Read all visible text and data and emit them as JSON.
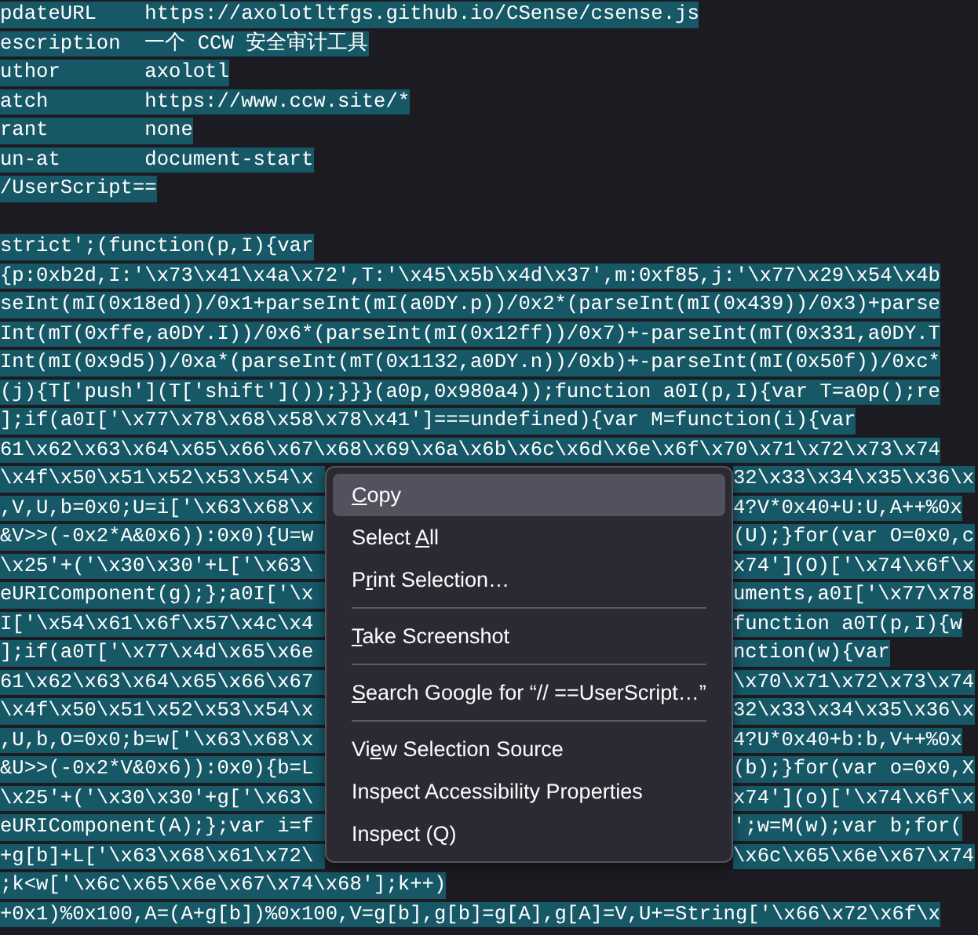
{
  "editor": {
    "selected": true,
    "header_lines": [
      "pdateURL    https://axolotltfgs.github.io/CSense/csense.js",
      "escription  一个 CCW 安全审计工具",
      "uthor       axolotl",
      "atch        https://www.ccw.site/*",
      "rant        none",
      "un-at       document-start",
      "/UserScript=="
    ],
    "code_lines": [
      {
        "kind": "full",
        "text": "strict';(function(p,I){var"
      },
      {
        "kind": "full",
        "text": "{p:0xb2d,I:'\\x73\\x41\\x4a\\x72',T:'\\x45\\x5b\\x4d\\x37',m:0xf85,j:'\\x77\\x29\\x54\\x4b"
      },
      {
        "kind": "full",
        "text": "seInt(mI(0x18ed))/0x1+parseInt(mI(a0DY.p))/0x2*(parseInt(mI(0x439))/0x3)+parse"
      },
      {
        "kind": "full",
        "text": "Int(mT(0xffe,a0DY.I))/0x6*(parseInt(mI(0x12ff))/0x7)+-parseInt(mT(0x331,a0DY.T"
      },
      {
        "kind": "full",
        "text": "Int(mI(0x9d5))/0xa*(parseInt(mT(0x1132,a0DY.n))/0xb)+-parseInt(mI(0x50f))/0xc*"
      },
      {
        "kind": "full",
        "text": "(j){T['push'](T['shift']());}}}(a0p,0x980a4));function a0I(p,I){var T=a0p();re"
      },
      {
        "kind": "full",
        "text": "];if(a0I['\\x77\\x78\\x68\\x58\\x78\\x41']===undefined){var M=function(i){var"
      },
      {
        "kind": "full",
        "text": "61\\x62\\x63\\x64\\x65\\x66\\x67\\x68\\x69\\x6a\\x6b\\x6c\\x6d\\x6e\\x6f\\x70\\x71\\x72\\x73\\x74"
      },
      {
        "kind": "split",
        "left": "\\x4f\\x50\\x51\\x52\\x53\\x54\\x",
        "right": "32\\x33\\x34\\x35\\x36\\x"
      },
      {
        "kind": "split",
        "left": ",V,U,b=0x0;U=i['\\x63\\x68\\x",
        "right": "4?V*0x40+U:U,A++%0x"
      },
      {
        "kind": "split",
        "left": "&V>>(-0x2*A&0x6)):0x0){U=w",
        "right": "(U);}for(var O=0x0,c"
      },
      {
        "kind": "split",
        "left": "\\x25'+('\\x30\\x30'+L['\\x63\\",
        "right": "x74'](O)['\\x74\\x6f\\x"
      },
      {
        "kind": "split",
        "left": "eURIComponent(g);};a0I['\\x",
        "right": "uments,a0I['\\x77\\x78"
      },
      {
        "kind": "split",
        "left": "I['\\x54\\x61\\x6f\\x57\\x4c\\x4",
        "right": "function a0T(p,I){w"
      },
      {
        "kind": "split",
        "left": "];if(a0T['\\x77\\x4d\\x65\\x6e",
        "right": "nction(w){var"
      },
      {
        "kind": "split",
        "left": "61\\x62\\x63\\x64\\x65\\x66\\x67",
        "right": "\\x70\\x71\\x72\\x73\\x74"
      },
      {
        "kind": "split",
        "left": "\\x4f\\x50\\x51\\x52\\x53\\x54\\x",
        "right": "32\\x33\\x34\\x35\\x36\\x"
      },
      {
        "kind": "split",
        "left": ",U,b,O=0x0;b=w['\\x63\\x68\\x",
        "right": "4?U*0x40+b:b,V++%0x"
      },
      {
        "kind": "split",
        "left": "&U>>(-0x2*V&0x6)):0x0){b=L",
        "right": "(b);}for(var o=0x0,X"
      },
      {
        "kind": "split",
        "left": "\\x25'+('\\x30\\x30'+g['\\x63\\",
        "right": "x74'](o)['\\x74\\x6f\\x"
      },
      {
        "kind": "split",
        "left": "eURIComponent(A);};var i=f",
        "right": "';w=M(w);var b;for("
      },
      {
        "kind": "split",
        "left": "+g[b]+L['\\x63\\x68\\x61\\x72\\",
        "right": "\\x6c\\x65\\x6e\\x67\\x74"
      },
      {
        "kind": "full",
        "text": ";k<w['\\x6c\\x65\\x6e\\x67\\x74\\x68'];k++)"
      },
      {
        "kind": "full",
        "text": "+0x1)%0x100,A=(A+g[b])%0x100,V=g[b],g[b]=g[A],g[A]=V,U+=String['\\x66\\x72\\x6f\\x"
      }
    ]
  },
  "context_menu": {
    "items": [
      {
        "kind": "item",
        "selected": true,
        "parts": [
          {
            "text": "C",
            "underline": true
          },
          {
            "text": "opy",
            "underline": false
          }
        ]
      },
      {
        "kind": "item",
        "selected": false,
        "parts": [
          {
            "text": "Select ",
            "underline": false
          },
          {
            "text": "A",
            "underline": true
          },
          {
            "text": "ll",
            "underline": false
          }
        ]
      },
      {
        "kind": "item",
        "selected": false,
        "parts": [
          {
            "text": "P",
            "underline": false
          },
          {
            "text": "r",
            "underline": true
          },
          {
            "text": "int Selection…",
            "underline": false
          }
        ]
      },
      {
        "kind": "separator"
      },
      {
        "kind": "item",
        "selected": false,
        "parts": [
          {
            "text": "T",
            "underline": true
          },
          {
            "text": "ake Screenshot",
            "underline": false
          }
        ]
      },
      {
        "kind": "separator"
      },
      {
        "kind": "item",
        "selected": false,
        "parts": [
          {
            "text": "S",
            "underline": true
          },
          {
            "text": "earch Google for “// ==UserScript…”",
            "underline": false
          }
        ]
      },
      {
        "kind": "separator"
      },
      {
        "kind": "item",
        "selected": false,
        "parts": [
          {
            "text": "Vi",
            "underline": false
          },
          {
            "text": "e",
            "underline": true
          },
          {
            "text": "w Selection Source",
            "underline": false
          }
        ]
      },
      {
        "kind": "item",
        "selected": false,
        "parts": [
          {
            "text": "Inspect Accessibility Properties",
            "underline": false
          }
        ]
      },
      {
        "kind": "item",
        "selected": false,
        "parts": [
          {
            "text": "Inspect (Q)",
            "underline": false
          }
        ]
      }
    ]
  }
}
